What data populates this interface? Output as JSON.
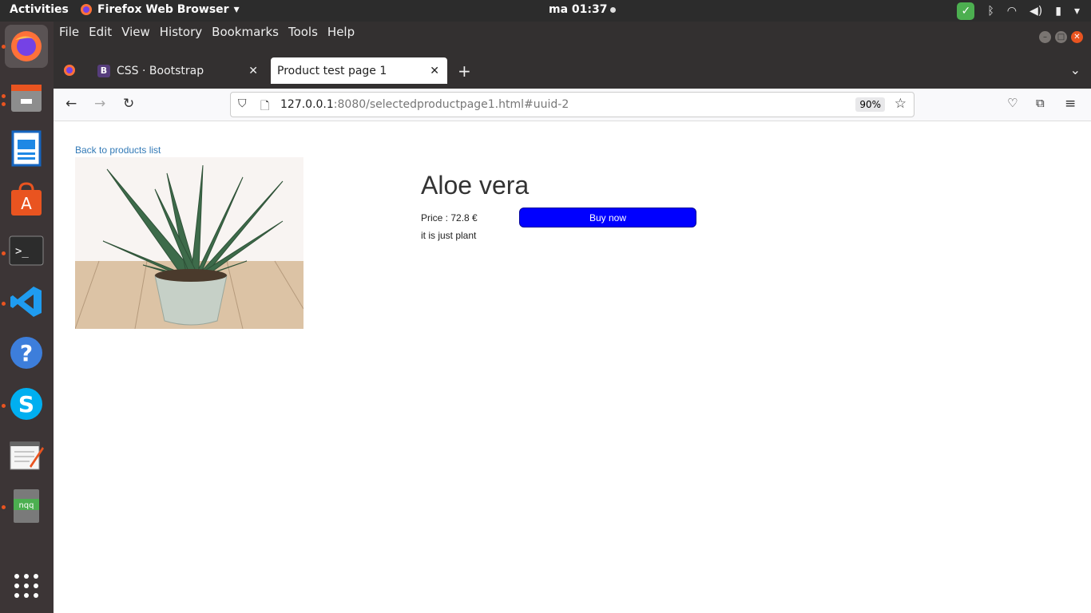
{
  "topbar": {
    "activities": "Activities",
    "app_name": "Firefox Web Browser",
    "clock": "ma 01:37"
  },
  "dock": {
    "items": [
      "firefox-icon",
      "files-icon",
      "writer-icon",
      "software-center-icon",
      "terminal-icon",
      "vscode-icon",
      "help-icon",
      "skype-icon",
      "text-editor-icon",
      "nqq-icon",
      "app-grid-icon"
    ],
    "nqq_label": "nqq"
  },
  "menubar": {
    "file": "File",
    "edit": "Edit",
    "view": "View",
    "history": "History",
    "bookmarks": "Bookmarks",
    "tools": "Tools",
    "help": "Help"
  },
  "tabs": [
    {
      "label": "CSS · Bootstrap",
      "favicon": "B"
    },
    {
      "label": "Product test page 1"
    }
  ],
  "url": {
    "host": "127.0.0.1",
    "rest": ":8080/selectedproductpage1.html#uuid-2",
    "zoom": "90%"
  },
  "page": {
    "back_link": "Back to products list",
    "product_name": "Aloe vera",
    "price": "Price : 72.8 €",
    "description": "it is just plant",
    "buy_label": "Buy now"
  },
  "colors": {
    "buy_button": "#0000ff",
    "link": "#337ab7",
    "ubuntu_orange": "#e95420"
  }
}
